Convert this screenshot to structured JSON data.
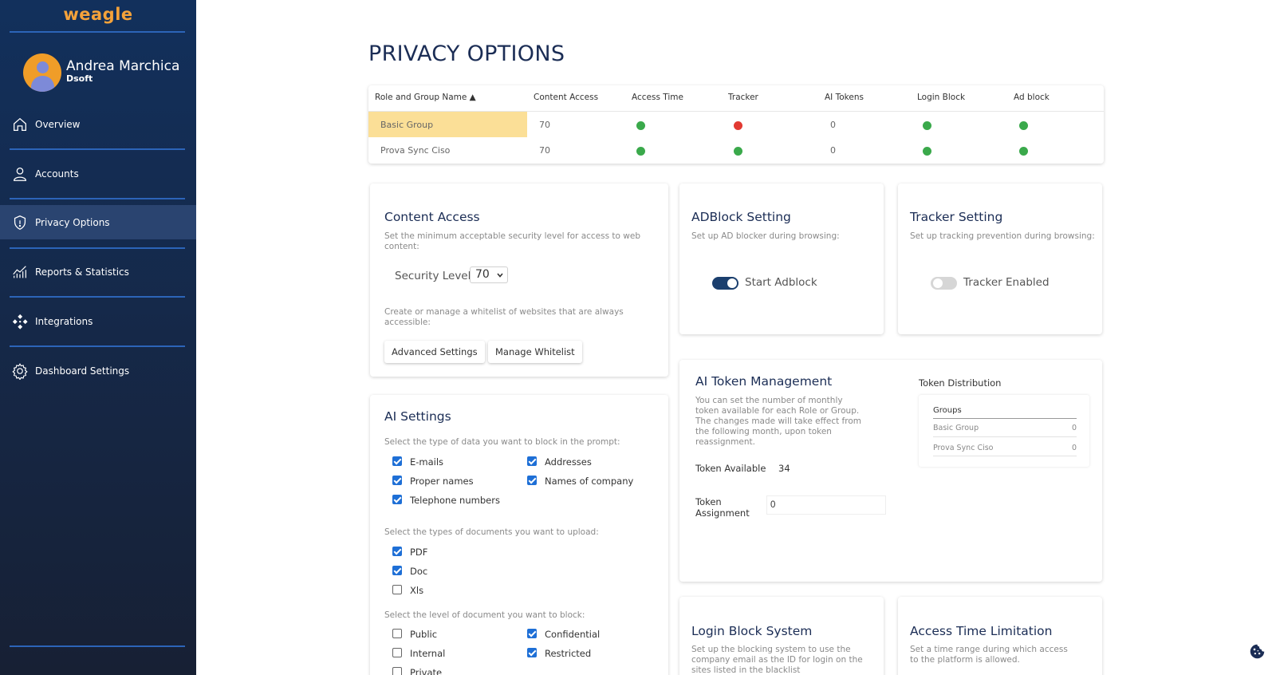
{
  "app": {
    "logo": "weagle"
  },
  "user": {
    "name": "Andrea Marchica",
    "org": "Dsoft"
  },
  "sidebar": {
    "items": [
      {
        "label": "Overview",
        "icon": "home-icon"
      },
      {
        "label": "Accounts",
        "icon": "user-icon"
      },
      {
        "label": "Privacy Options",
        "icon": "shield-icon",
        "active": true
      },
      {
        "label": "Reports & Statistics",
        "icon": "chart-icon"
      },
      {
        "label": "Integrations",
        "icon": "integrations-icon"
      },
      {
        "label": "Dashboard Settings",
        "icon": "gear-icon"
      }
    ]
  },
  "page": {
    "title": "PRIVACY OPTIONS"
  },
  "table": {
    "headers": [
      "Role and Group Name ▲",
      "Content Access",
      "Access Time",
      "Tracker",
      "AI Tokens",
      "Login Block",
      "Ad block"
    ],
    "rows": [
      {
        "name": "Basic Group",
        "content_access": "70",
        "access_time": "green",
        "tracker": "red",
        "ai_tokens": "0",
        "login_block": "green",
        "ad_block": "green",
        "selected": true
      },
      {
        "name": "Prova Sync Ciso",
        "content_access": "70",
        "access_time": "green",
        "tracker": "green",
        "ai_tokens": "0",
        "login_block": "green",
        "ad_block": "green"
      }
    ],
    "status_colors": {
      "green": "#3aa94b",
      "red": "#e23a32"
    }
  },
  "content_access": {
    "title": "Content Access",
    "desc": "Set the minimum acceptable security level for access to web content:",
    "security_label": "Security Level",
    "security_value": "70",
    "whitelist_desc": "Create or manage a whitelist of websites that are always accessible:",
    "advanced_btn": "Advanced Settings",
    "whitelist_btn": "Manage Whitelist"
  },
  "adblock": {
    "title": "ADBlock Setting",
    "desc": "Set up AD blocker during browsing:",
    "toggle_label": "Start Adblock",
    "enabled": true
  },
  "tracker": {
    "title": "Tracker Setting",
    "desc": "Set up tracking prevention during browsing:",
    "toggle_label": "Tracker Enabled",
    "enabled": false
  },
  "ai_settings": {
    "title": "AI Settings",
    "data_desc": "Select the type of data you want to block in the prompt:",
    "data_options": [
      {
        "label": "E-mails",
        "checked": true
      },
      {
        "label": "Addresses",
        "checked": true
      },
      {
        "label": "Proper names",
        "checked": true
      },
      {
        "label": "Names of company",
        "checked": true
      },
      {
        "label": "Telephone numbers",
        "checked": true
      }
    ],
    "docs_desc": "Select the types of documents you want to upload:",
    "doc_options": [
      {
        "label": "PDF",
        "checked": true
      },
      {
        "label": "Doc",
        "checked": true
      },
      {
        "label": "Xls",
        "checked": false
      }
    ],
    "level_desc": "Select the level of document you want to block:",
    "level_options": [
      {
        "label": "Public",
        "checked": false
      },
      {
        "label": "Confidential",
        "checked": true
      },
      {
        "label": "Internal",
        "checked": false
      },
      {
        "label": "Restricted",
        "checked": true
      },
      {
        "label": "Private",
        "checked": false
      }
    ]
  },
  "ai_tokens": {
    "title": "AI Token Management",
    "desc": "You can set the number of monthly token available for each Role or Group. The changes made will take effect from the following month, upon token reassignment.",
    "available_label": "Token Available",
    "available_value": "34",
    "assignment_label": "Token Assignment",
    "assignment_value": "0",
    "distribution_title": "Token Distribution",
    "distribution_header": "Groups",
    "distribution": [
      {
        "name": "Basic Group",
        "value": "0"
      },
      {
        "name": "Prova Sync Ciso",
        "value": "0"
      }
    ]
  },
  "login_block": {
    "title": "Login Block System",
    "desc": "Set up the blocking system to use the company email as the ID for login on the sites listed in the blacklist"
  },
  "access_time": {
    "title": "Access Time Limitation",
    "desc": "Set a time range during which access to the platform is allowed."
  },
  "colors": {
    "sidebar": "#15294a",
    "accent": "#1e6fd6",
    "title": "#1b2d55",
    "logo": "#f4a23a",
    "toggle_on": "#1b3f6e"
  }
}
